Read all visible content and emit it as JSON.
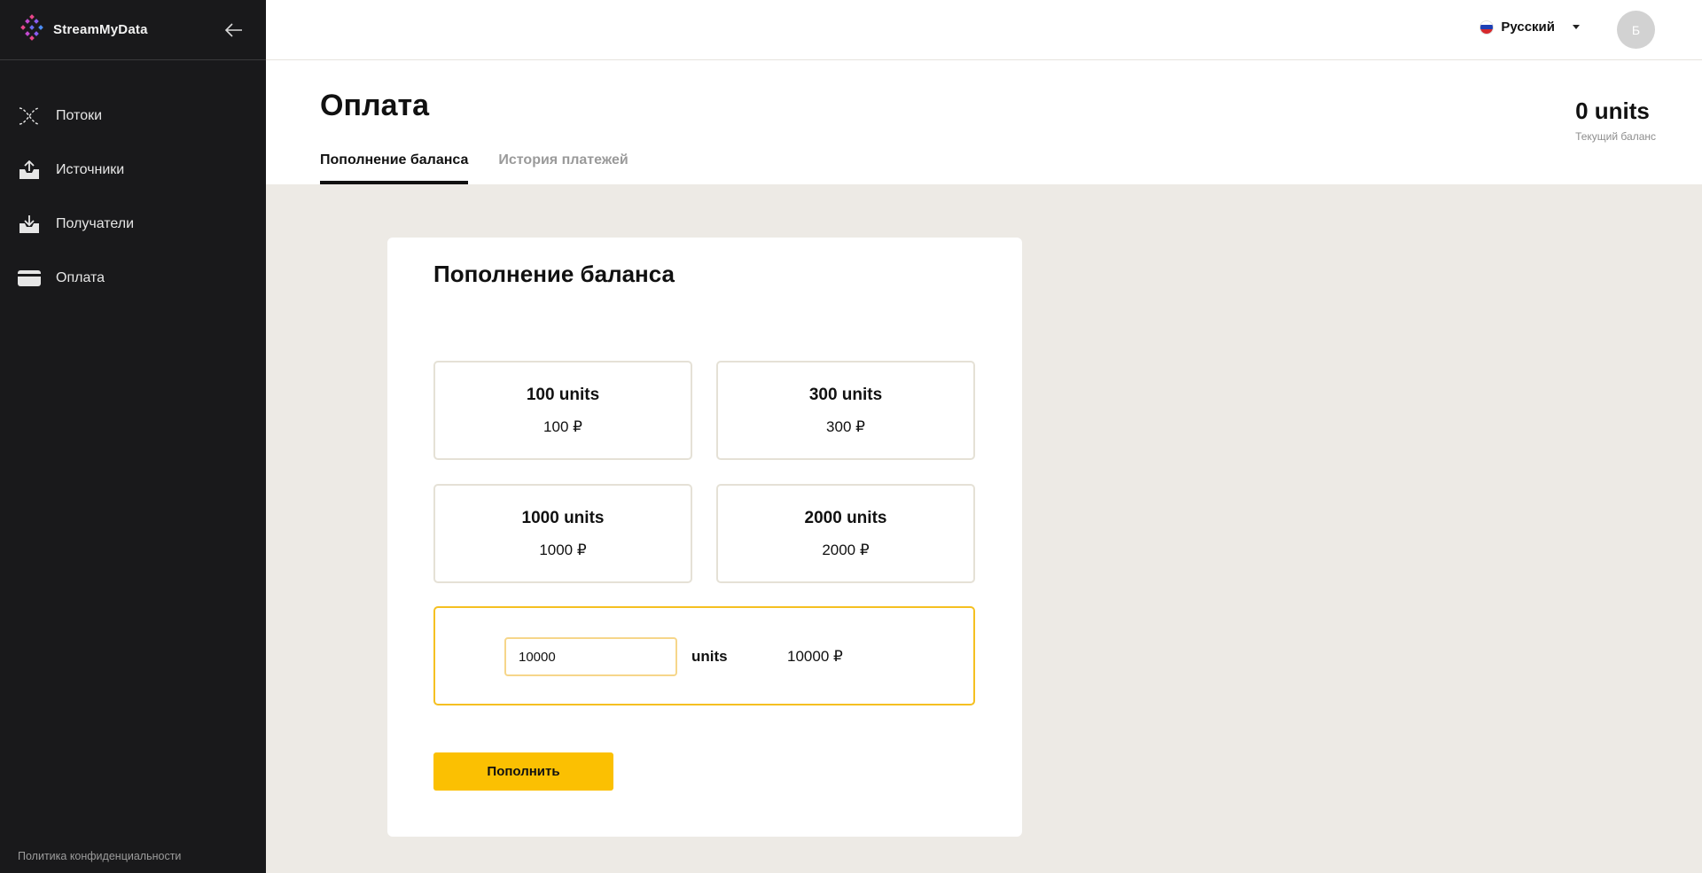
{
  "sidebar": {
    "brand": "StreamMyData",
    "items": [
      {
        "label": "Потоки",
        "icon": "streams-icon"
      },
      {
        "label": "Источники",
        "icon": "upload-icon"
      },
      {
        "label": "Получатели",
        "icon": "download-icon"
      },
      {
        "label": "Оплата",
        "icon": "card-icon"
      }
    ],
    "privacy_link": "Политика конфиденциальности"
  },
  "topbar": {
    "language": "Русский",
    "avatar_initial": "Б"
  },
  "page": {
    "title": "Оплата",
    "balance_value": "0 units",
    "balance_caption": "Текущий баланс",
    "tabs": [
      {
        "label": "Пополнение баланса",
        "active": true
      },
      {
        "label": "История платежей",
        "active": false
      }
    ]
  },
  "card": {
    "title": "Пополнение баланса",
    "options": [
      {
        "units": "100 units",
        "price": "100 ₽"
      },
      {
        "units": "300 units",
        "price": "300 ₽"
      },
      {
        "units": "1000 units",
        "price": "1000 ₽"
      },
      {
        "units": "2000 units",
        "price": "2000 ₽"
      }
    ],
    "custom": {
      "value": "10000",
      "units_label": "units",
      "price": "10000 ₽"
    },
    "submit_label": "Пополнить"
  },
  "colors": {
    "sidebar_bg": "#19191b",
    "accent": "#fbc002",
    "content_bg": "#edeae5"
  }
}
